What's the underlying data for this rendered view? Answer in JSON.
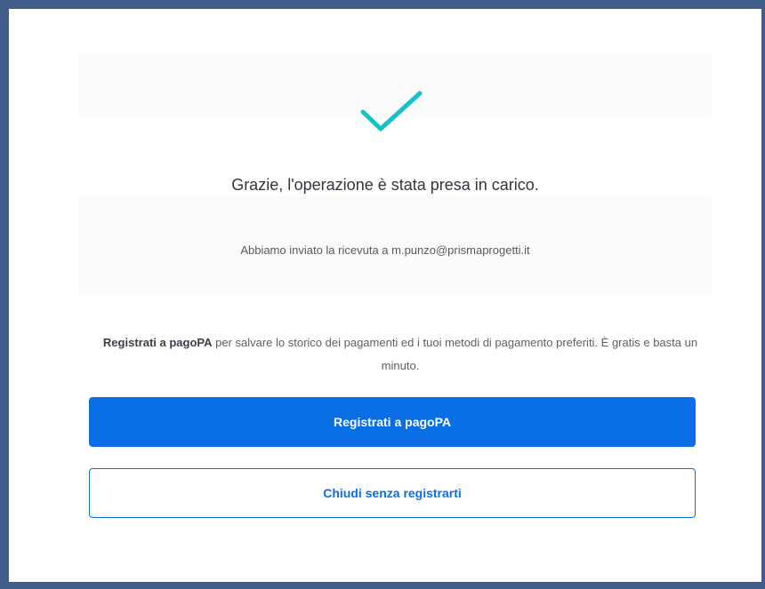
{
  "icon": {
    "name": "checkmark-icon",
    "color": "#17c1c9"
  },
  "confirmation": {
    "title": "Grazie, l'operazione è stata presa in carico.",
    "receipt_text": "Abbiamo inviato la ricevuta a m.punzo@prismaprogetti.it"
  },
  "promo": {
    "strong_text": "Registrati a pagoPA",
    "rest_text": " per salvare lo storico dei pagamenti ed i tuoi metodi di pagamento preferiti. È gratis e basta un minuto."
  },
  "buttons": {
    "register_label": "Registrati a pagoPA",
    "close_label": "Chiudi senza registrarti"
  },
  "colors": {
    "primary": "#0a6fe5",
    "frame": "#3f5f8a",
    "accent": "#17c1c9"
  }
}
